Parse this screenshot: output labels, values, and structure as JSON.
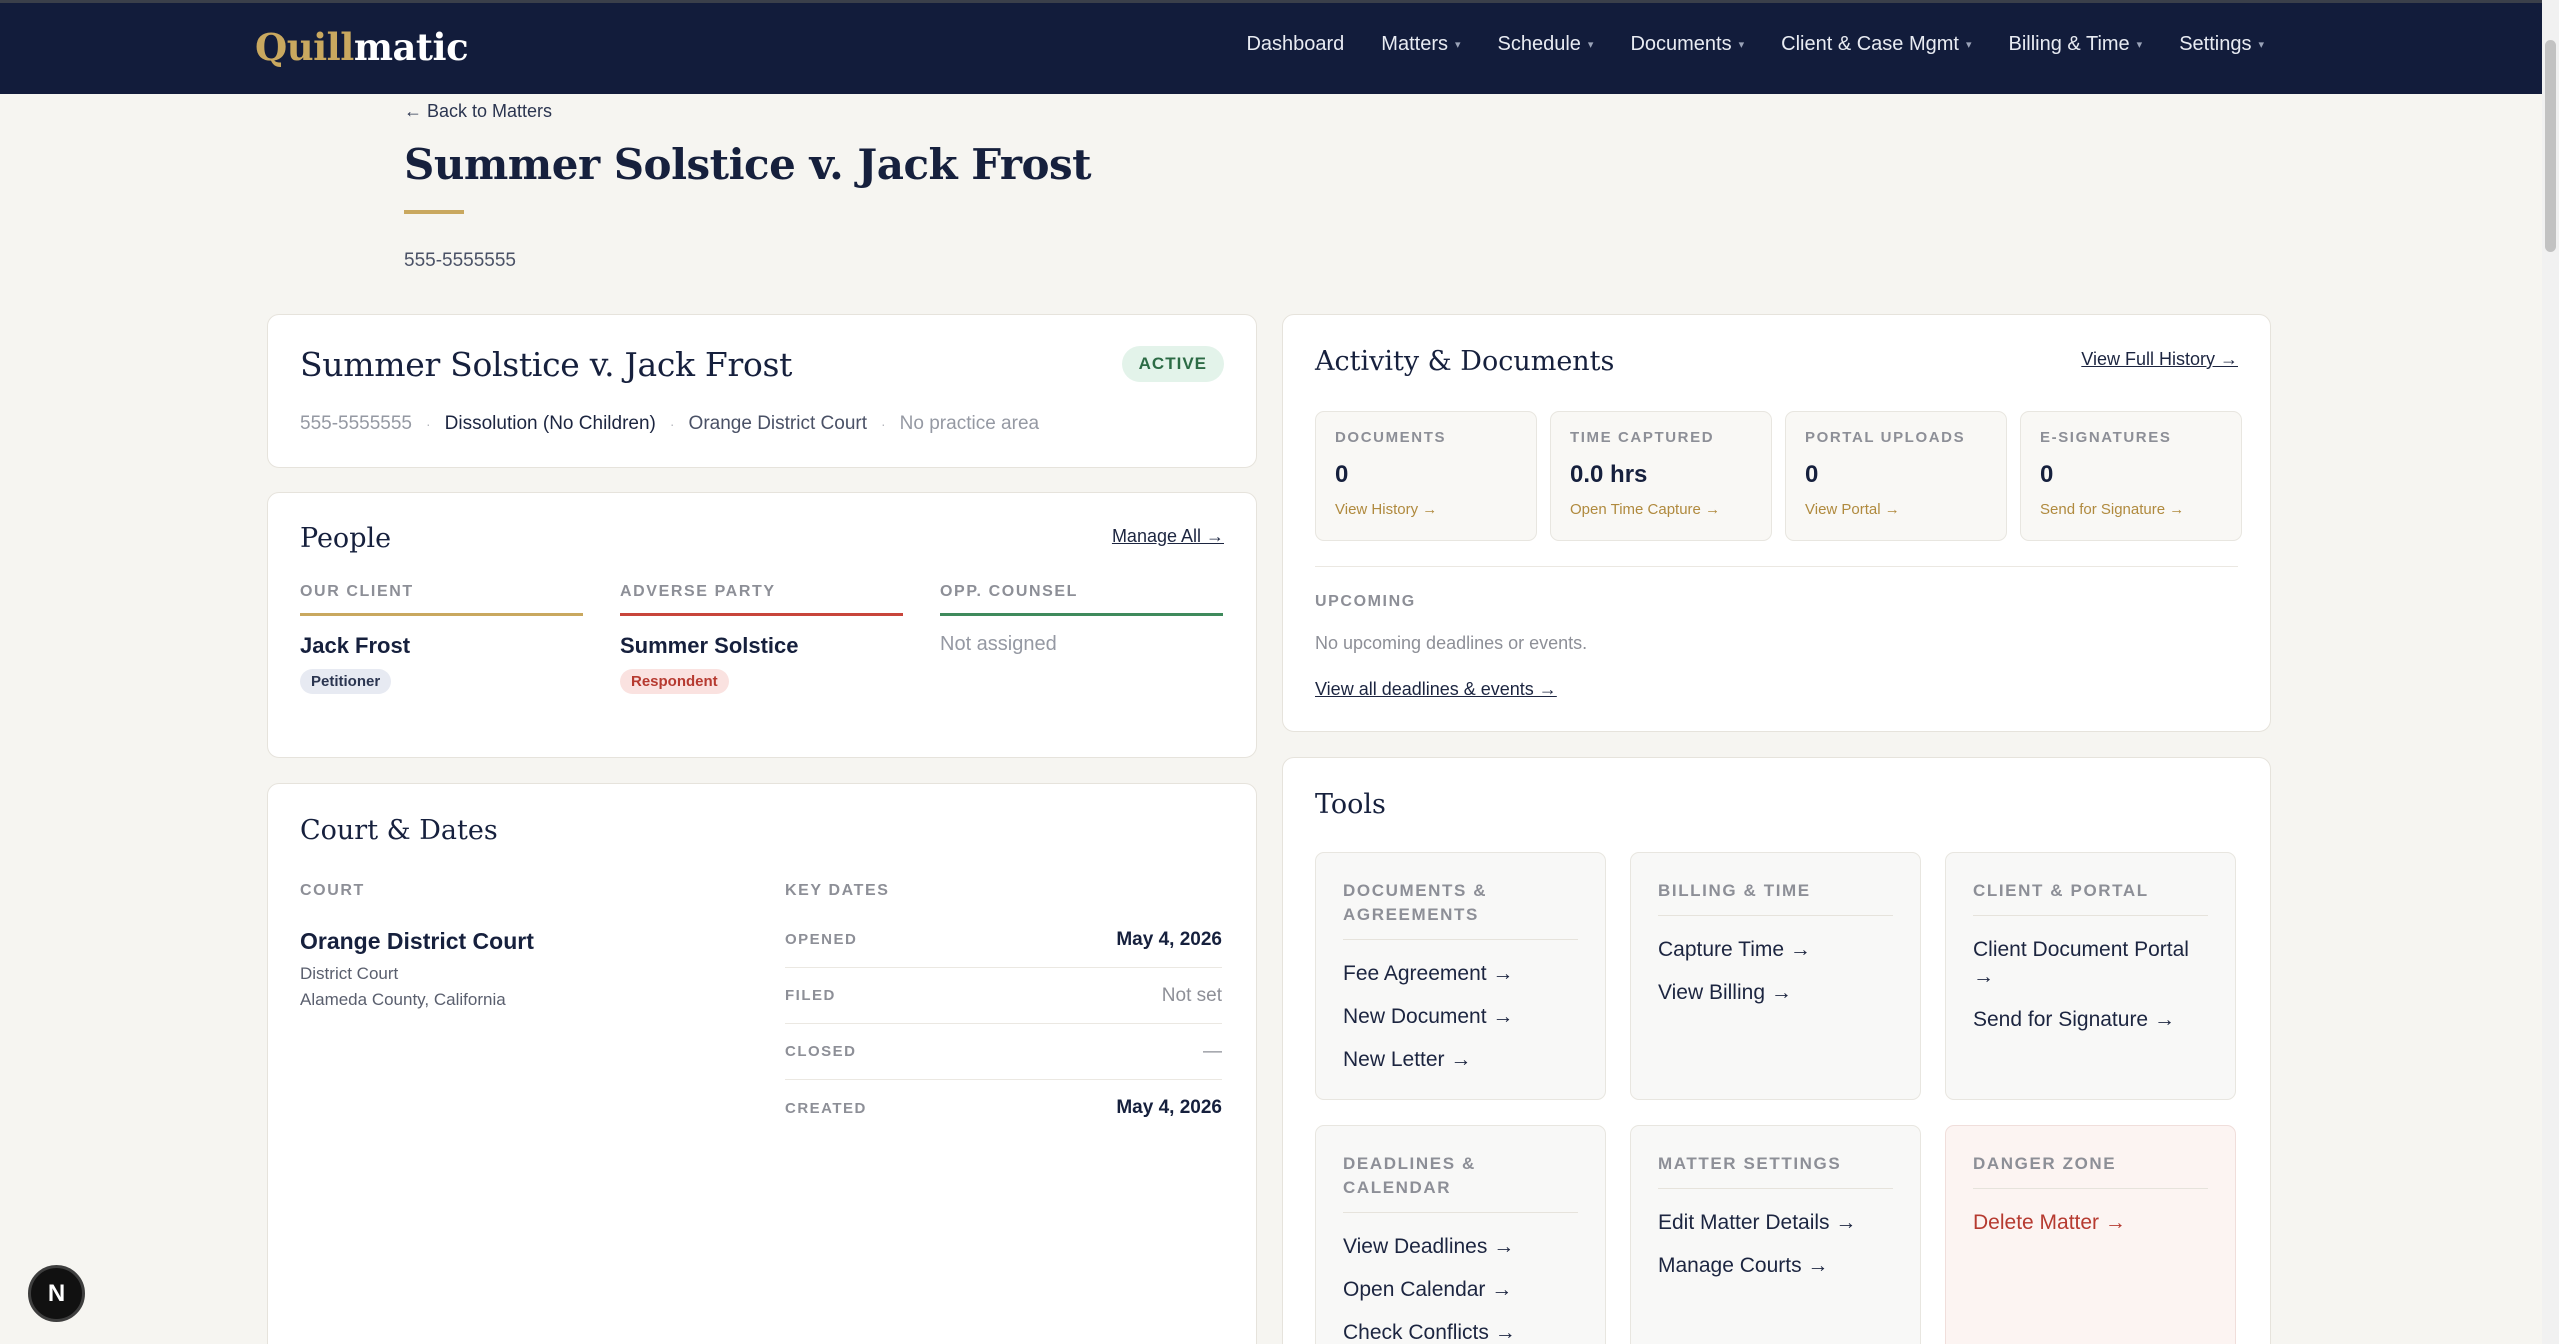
{
  "brand": {
    "part1": "Quill",
    "part2": "matic"
  },
  "nav": {
    "items": [
      {
        "label": "Dashboard",
        "caret": false
      },
      {
        "label": "Matters",
        "caret": true
      },
      {
        "label": "Schedule",
        "caret": true
      },
      {
        "label": "Documents",
        "caret": true
      },
      {
        "label": "Client & Case Mgmt",
        "caret": true
      },
      {
        "label": "Billing & Time",
        "caret": true
      },
      {
        "label": "Settings",
        "caret": true
      }
    ]
  },
  "header": {
    "back_label": "← Back to Matters",
    "title": "Summer Solstice v. Jack Frost",
    "subtitle": "555-5555555"
  },
  "summary": {
    "title": "Summer Solstice v. Jack Frost",
    "status": "ACTIVE",
    "case_number": "555-5555555",
    "case_type": "Dissolution (No Children)",
    "court": "Orange District Court",
    "practice_area": "No practice area",
    "separator": "·"
  },
  "people": {
    "title": "People",
    "manage_label": "Manage All →",
    "client": {
      "label": "OUR CLIENT",
      "name": "Jack Frost",
      "role": "Petitioner"
    },
    "adverse": {
      "label": "ADVERSE PARTY",
      "name": "Summer Solstice",
      "role": "Respondent"
    },
    "counsel": {
      "label": "OPP. COUNSEL",
      "name": "Not assigned"
    },
    "colors": {
      "client": "#c9a85f",
      "adverse": "#c8453b",
      "counsel": "#3f8a5c"
    }
  },
  "court_dates": {
    "title": "Court & Dates",
    "court_label": "COURT",
    "court_name": "Orange District Court",
    "court_type": "District Court",
    "court_location": "Alameda County, California",
    "key_dates_label": "KEY DATES",
    "dates": [
      {
        "label": "OPENED",
        "value": "May 4, 2026"
      },
      {
        "label": "FILED",
        "value": "Not set"
      },
      {
        "label": "CLOSED",
        "value": "—"
      },
      {
        "label": "CREATED",
        "value": "May 4, 2026"
      }
    ]
  },
  "activity": {
    "title": "Activity & Documents",
    "history_label": "View Full History →",
    "stats": [
      {
        "label": "DOCUMENTS",
        "value": "0",
        "link": "View History →"
      },
      {
        "label": "TIME CAPTURED",
        "value": "0.0 hrs",
        "link": "Open Time Capture →"
      },
      {
        "label": "PORTAL UPLOADS",
        "value": "0",
        "link": "View Portal →"
      },
      {
        "label": "E-SIGNATURES",
        "value": "0",
        "link": "Send for Signature →"
      }
    ],
    "upcoming_label": "UPCOMING",
    "upcoming_empty": "No upcoming deadlines or events.",
    "view_all_label": "View all deadlines & events →"
  },
  "tools": {
    "title": "Tools",
    "groups": [
      {
        "label": "DOCUMENTS & AGREEMENTS",
        "links": [
          "Fee Agreement →",
          "New Document →",
          "New Letter →"
        ]
      },
      {
        "label": "BILLING & TIME",
        "links": [
          "Capture Time →",
          "View Billing →"
        ]
      },
      {
        "label": "CLIENT & PORTAL",
        "links": [
          "Client Document Portal →",
          "Send for Signature →"
        ]
      },
      {
        "label": "DEADLINES & CALENDAR",
        "links": [
          "View Deadlines →",
          "Open Calendar →",
          "Check Conflicts →"
        ]
      },
      {
        "label": "MATTER SETTINGS",
        "links": [
          "Edit Matter Details →",
          "Manage Courts →"
        ]
      },
      {
        "label": "DANGER ZONE",
        "links": [
          "Delete Matter →"
        ]
      }
    ]
  },
  "fab": {
    "label": "N"
  }
}
